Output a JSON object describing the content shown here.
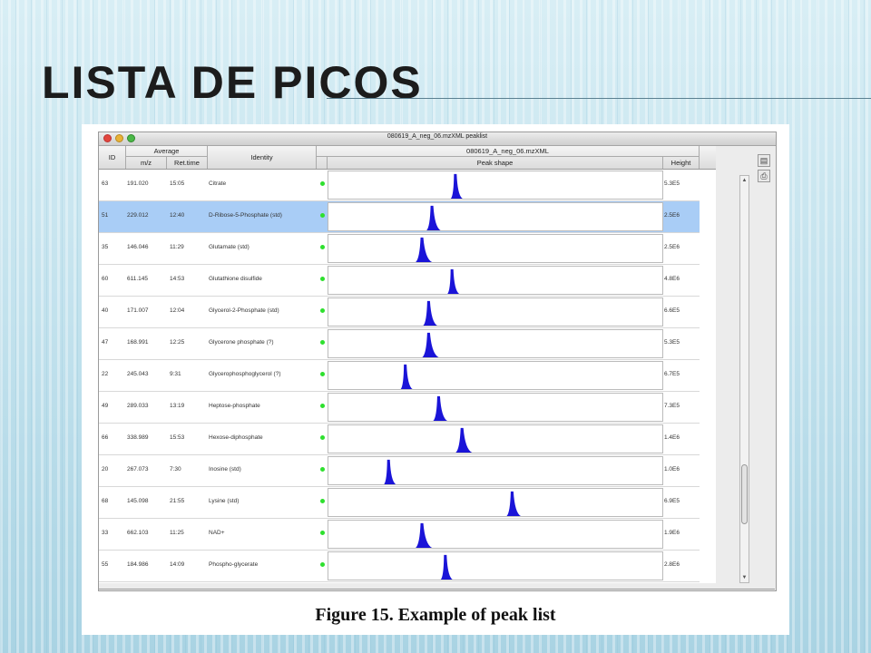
{
  "slide": {
    "title": "LISTA DE PICOS"
  },
  "window": {
    "title": "080619_A_neg_06.mzXML peaklist"
  },
  "table": {
    "headers": {
      "id": "ID",
      "average_group": "Average",
      "mz": "m/z",
      "rt": "Ret.time",
      "identity": "Identity",
      "file_group": "080619_A_neg_06.mzXML",
      "peak_shape": "Peak shape",
      "height": "Height"
    },
    "rows": [
      {
        "id": "63",
        "mz": "191.020",
        "rt": "15:05",
        "identity": "Citrate",
        "height": "5.3E5",
        "peak": 0.38
      },
      {
        "id": "51",
        "mz": "229.012",
        "rt": "12:40",
        "identity": "D-Ribose-5-Phosphate (std)",
        "height": "2.5E6",
        "peak": 0.31,
        "selected": true
      },
      {
        "id": "35",
        "mz": "146.046",
        "rt": "11:29",
        "identity": "Glutamate (std)",
        "height": "2.5E6",
        "peak": 0.28
      },
      {
        "id": "60",
        "mz": "611.145",
        "rt": "14:53",
        "identity": "Glutathione disulfide",
        "height": "4.8E6",
        "peak": 0.37
      },
      {
        "id": "40",
        "mz": "171.007",
        "rt": "12:04",
        "identity": "Glycerol-2-Phosphate (std)",
        "height": "6.6E5",
        "peak": 0.3
      },
      {
        "id": "47",
        "mz": "168.991",
        "rt": "12:25",
        "identity": "Glycerone phosphate (?)",
        "height": "5.3E5",
        "peak": 0.3
      },
      {
        "id": "22",
        "mz": "245.043",
        "rt": "9:31",
        "identity": "Glycerophosphoglycerol (?)",
        "height": "6.7E5",
        "peak": 0.23
      },
      {
        "id": "49",
        "mz": "289.033",
        "rt": "13:19",
        "identity": "Heptose-phosphate",
        "height": "7.3E5",
        "peak": 0.33
      },
      {
        "id": "66",
        "mz": "338.989",
        "rt": "15:53",
        "identity": "Hexose-diphosphate",
        "height": "1.4E6",
        "peak": 0.4
      },
      {
        "id": "20",
        "mz": "267.073",
        "rt": "7:30",
        "identity": "Inosine (std)",
        "height": "1.0E6",
        "peak": 0.18
      },
      {
        "id": "68",
        "mz": "145.098",
        "rt": "21:55",
        "identity": "Lysine (std)",
        "height": "6.9E5",
        "peak": 0.55
      },
      {
        "id": "33",
        "mz": "662.103",
        "rt": "11:25",
        "identity": "NAD+",
        "height": "1.9E6",
        "peak": 0.28
      },
      {
        "id": "55",
        "mz": "184.986",
        "rt": "14:09",
        "identity": "Phospho-glycerate",
        "height": "2.8E6",
        "peak": 0.35
      }
    ]
  },
  "caption": "Figure 15. Example of peak list",
  "colors": {
    "peak": "#1a14d8",
    "selected_row": "#a9cdf6",
    "status_dot": "#2ee02e"
  }
}
